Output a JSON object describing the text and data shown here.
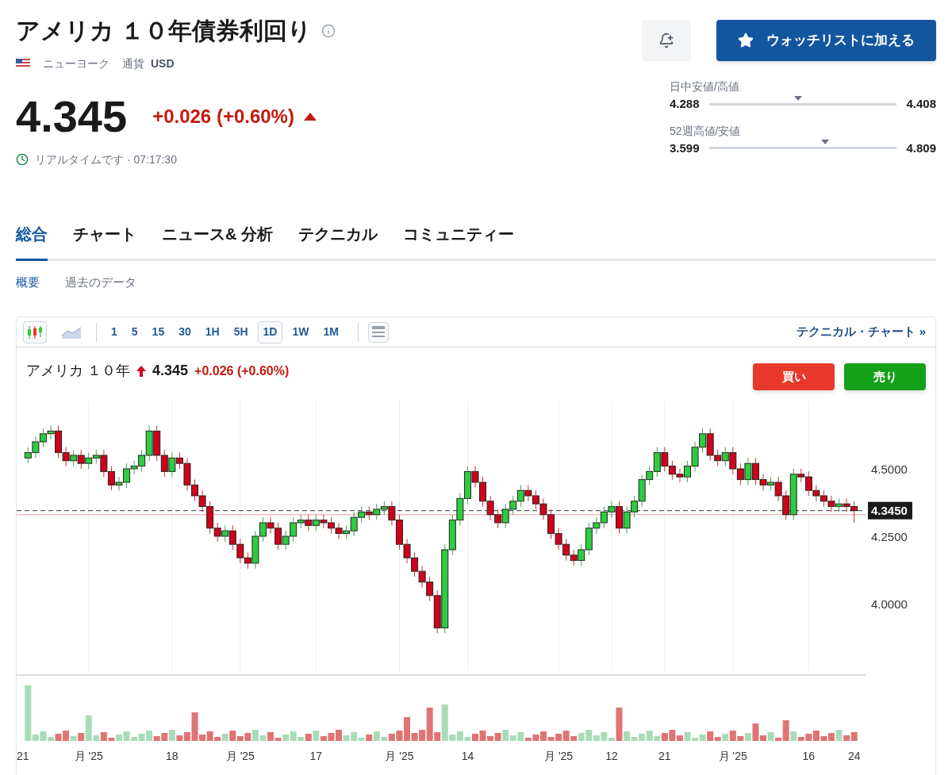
{
  "header": {
    "title": "アメリカ １０年債券利回り",
    "exchange": "ニューヨーク",
    "currency_label": "通貨",
    "currency": "USD",
    "watchlist_button": "ウォッチリストに加える"
  },
  "quote": {
    "price": "4.345",
    "change": "+0.026 (+0.60%)",
    "status": "リアルタイムです · 07:17:30"
  },
  "ranges": [
    {
      "label": "日中安値/高値",
      "low": "4.288",
      "high": "4.408",
      "level": 0.475
    },
    {
      "label": "52週高値/安値",
      "low": "3.599",
      "high": "4.809",
      "level": 0.62
    }
  ],
  "tabs": [
    {
      "label": "総合",
      "selected": true
    },
    {
      "label": "チャート",
      "selected": false
    },
    {
      "label": "ニュース& 分析",
      "selected": false
    },
    {
      "label": "テクニカル",
      "selected": false
    },
    {
      "label": "コミュニティー",
      "selected": false
    }
  ],
  "subtabs": [
    {
      "label": "概要",
      "selected": true
    },
    {
      "label": "過去のデータ",
      "selected": false
    }
  ],
  "chart_types": [
    {
      "kind": "candles",
      "selected": true
    },
    {
      "kind": "area",
      "selected": false
    }
  ],
  "intervals": [
    {
      "label": "1",
      "selected": false
    },
    {
      "label": "5",
      "selected": false
    },
    {
      "label": "15",
      "selected": false
    },
    {
      "label": "30",
      "selected": false
    },
    {
      "label": "1H",
      "selected": false
    },
    {
      "label": "5H",
      "selected": false
    },
    {
      "label": "1D",
      "selected": true
    },
    {
      "label": "1W",
      "selected": false
    },
    {
      "label": "1M",
      "selected": false
    }
  ],
  "technical_link": "テクニカル・チャート »",
  "legend": {
    "name": "アメリカ １０年",
    "price": "4.345",
    "change": "+0.026 (+0.60%)"
  },
  "buy_button": "買い",
  "sell_button": "売り",
  "chart_data": {
    "type": "candlestick",
    "ylim": [
      3.75,
      4.75
    ],
    "ref_lines": [
      {
        "axis": "y",
        "value": 4.345,
        "label": "4.3450",
        "color": "#333333"
      },
      {
        "axis": "y",
        "value": 4.33,
        "color": "#e4a0a0"
      }
    ],
    "categories": [
      "21",
      null,
      null,
      null,
      null,
      null,
      null,
      null,
      "月 '25",
      null,
      null,
      null,
      null,
      null,
      null,
      null,
      null,
      null,
      null,
      "18",
      null,
      null,
      null,
      null,
      null,
      null,
      null,
      null,
      "月 '25",
      null,
      null,
      null,
      null,
      null,
      null,
      null,
      null,
      null,
      "17",
      null,
      null,
      null,
      null,
      null,
      null,
      null,
      null,
      null,
      null,
      "月 '25",
      null,
      null,
      null,
      null,
      null,
      null,
      null,
      null,
      "14",
      null,
      null,
      null,
      null,
      null,
      null,
      null,
      null,
      null,
      null,
      null,
      "月 '25",
      null,
      null,
      null,
      null,
      null,
      null,
      "12",
      null,
      null,
      null,
      null,
      null,
      null,
      "21",
      null,
      null,
      null,
      null,
      null,
      null,
      null,
      null,
      "月 '25",
      null,
      null,
      null,
      null,
      null,
      null,
      null,
      null,
      null,
      "16",
      null,
      null,
      null,
      null,
      null,
      "24"
    ],
    "ohlc": [
      [
        4.54,
        4.58,
        4.52,
        4.56
      ],
      [
        4.56,
        4.62,
        4.54,
        4.6
      ],
      [
        4.6,
        4.65,
        4.58,
        4.63
      ],
      [
        4.63,
        4.66,
        4.61,
        4.64
      ],
      [
        4.64,
        4.66,
        4.54,
        4.56
      ],
      [
        4.56,
        4.58,
        4.51,
        4.53
      ],
      [
        4.53,
        4.57,
        4.51,
        4.55
      ],
      [
        4.55,
        4.57,
        4.5,
        4.52
      ],
      [
        4.52,
        4.56,
        4.5,
        4.54
      ],
      [
        4.54,
        4.57,
        4.52,
        4.55
      ],
      [
        4.55,
        4.57,
        4.47,
        4.49
      ],
      [
        4.49,
        4.51,
        4.42,
        4.44
      ],
      [
        4.44,
        4.47,
        4.42,
        4.45
      ],
      [
        4.45,
        4.52,
        4.43,
        4.5
      ],
      [
        4.5,
        4.53,
        4.48,
        4.51
      ],
      [
        4.51,
        4.57,
        4.49,
        4.55
      ],
      [
        4.55,
        4.66,
        4.53,
        4.64
      ],
      [
        4.64,
        4.66,
        4.53,
        4.55
      ],
      [
        4.55,
        4.57,
        4.47,
        4.49
      ],
      [
        4.49,
        4.56,
        4.47,
        4.54
      ],
      [
        4.54,
        4.56,
        4.5,
        4.52
      ],
      [
        4.52,
        4.54,
        4.42,
        4.44
      ],
      [
        4.44,
        4.46,
        4.38,
        4.4
      ],
      [
        4.4,
        4.42,
        4.34,
        4.36
      ],
      [
        4.36,
        4.38,
        4.26,
        4.28
      ],
      [
        4.28,
        4.3,
        4.23,
        4.25
      ],
      [
        4.25,
        4.29,
        4.23,
        4.27
      ],
      [
        4.27,
        4.29,
        4.2,
        4.22
      ],
      [
        4.22,
        4.24,
        4.15,
        4.17
      ],
      [
        4.17,
        4.19,
        4.13,
        4.15
      ],
      [
        4.15,
        4.27,
        4.13,
        4.25
      ],
      [
        4.25,
        4.32,
        4.23,
        4.3
      ],
      [
        4.3,
        4.32,
        4.26,
        4.28
      ],
      [
        4.28,
        4.3,
        4.2,
        4.22
      ],
      [
        4.22,
        4.27,
        4.2,
        4.25
      ],
      [
        4.25,
        4.32,
        4.23,
        4.3
      ],
      [
        4.3,
        4.33,
        4.28,
        4.31
      ],
      [
        4.31,
        4.33,
        4.27,
        4.29
      ],
      [
        4.29,
        4.33,
        4.27,
        4.31
      ],
      [
        4.31,
        4.33,
        4.28,
        4.3
      ],
      [
        4.3,
        4.32,
        4.26,
        4.28
      ],
      [
        4.28,
        4.3,
        4.24,
        4.26
      ],
      [
        4.26,
        4.29,
        4.24,
        4.27
      ],
      [
        4.27,
        4.34,
        4.25,
        4.32
      ],
      [
        4.32,
        4.36,
        4.3,
        4.34
      ],
      [
        4.34,
        4.36,
        4.31,
        4.33
      ],
      [
        4.33,
        4.37,
        4.31,
        4.35
      ],
      [
        4.35,
        4.38,
        4.33,
        4.36
      ],
      [
        4.36,
        4.38,
        4.29,
        4.31
      ],
      [
        4.31,
        4.33,
        4.2,
        4.22
      ],
      [
        4.22,
        4.24,
        4.15,
        4.17
      ],
      [
        4.17,
        4.19,
        4.1,
        4.12
      ],
      [
        4.12,
        4.14,
        4.06,
        4.08
      ],
      [
        4.08,
        4.1,
        4.01,
        4.03
      ],
      [
        4.03,
        4.05,
        3.89,
        3.91
      ],
      [
        3.91,
        4.22,
        3.89,
        4.2
      ],
      [
        4.2,
        4.33,
        4.18,
        4.31
      ],
      [
        4.31,
        4.41,
        4.29,
        4.39
      ],
      [
        4.39,
        4.51,
        4.37,
        4.49
      ],
      [
        4.49,
        4.51,
        4.43,
        4.45
      ],
      [
        4.45,
        4.47,
        4.36,
        4.38
      ],
      [
        4.38,
        4.4,
        4.31,
        4.33
      ],
      [
        4.33,
        4.35,
        4.28,
        4.3
      ],
      [
        4.3,
        4.37,
        4.28,
        4.35
      ],
      [
        4.35,
        4.4,
        4.33,
        4.38
      ],
      [
        4.38,
        4.44,
        4.36,
        4.42
      ],
      [
        4.42,
        4.44,
        4.38,
        4.4
      ],
      [
        4.4,
        4.42,
        4.35,
        4.37
      ],
      [
        4.37,
        4.39,
        4.31,
        4.33
      ],
      [
        4.33,
        4.35,
        4.24,
        4.26
      ],
      [
        4.26,
        4.28,
        4.2,
        4.22
      ],
      [
        4.22,
        4.24,
        4.16,
        4.18
      ],
      [
        4.18,
        4.2,
        4.14,
        4.16
      ],
      [
        4.16,
        4.22,
        4.14,
        4.2
      ],
      [
        4.2,
        4.3,
        4.18,
        4.28
      ],
      [
        4.28,
        4.32,
        4.26,
        4.3
      ],
      [
        4.3,
        4.36,
        4.28,
        4.34
      ],
      [
        4.34,
        4.38,
        4.32,
        4.36
      ],
      [
        4.36,
        4.38,
        4.26,
        4.28
      ],
      [
        4.28,
        4.36,
        4.26,
        4.34
      ],
      [
        4.34,
        4.4,
        4.32,
        4.38
      ],
      [
        4.38,
        4.48,
        4.36,
        4.46
      ],
      [
        4.46,
        4.51,
        4.44,
        4.49
      ],
      [
        4.49,
        4.58,
        4.47,
        4.56
      ],
      [
        4.56,
        4.58,
        4.49,
        4.51
      ],
      [
        4.51,
        4.53,
        4.46,
        4.48
      ],
      [
        4.48,
        4.5,
        4.45,
        4.47
      ],
      [
        4.47,
        4.53,
        4.45,
        4.51
      ],
      [
        4.51,
        4.6,
        4.49,
        4.58
      ],
      [
        4.58,
        4.65,
        4.56,
        4.63
      ],
      [
        4.63,
        4.65,
        4.53,
        4.55
      ],
      [
        4.55,
        4.57,
        4.51,
        4.53
      ],
      [
        4.53,
        4.58,
        4.51,
        4.56
      ],
      [
        4.56,
        4.58,
        4.48,
        4.5
      ],
      [
        4.5,
        4.52,
        4.44,
        4.46
      ],
      [
        4.46,
        4.54,
        4.44,
        4.52
      ],
      [
        4.52,
        4.54,
        4.44,
        4.46
      ],
      [
        4.46,
        4.48,
        4.42,
        4.44
      ],
      [
        4.44,
        4.47,
        4.42,
        4.45
      ],
      [
        4.45,
        4.47,
        4.38,
        4.4
      ],
      [
        4.4,
        4.42,
        4.31,
        4.33
      ],
      [
        4.33,
        4.5,
        4.31,
        4.48
      ],
      [
        4.48,
        4.5,
        4.45,
        4.47
      ],
      [
        4.47,
        4.49,
        4.4,
        4.42
      ],
      [
        4.42,
        4.44,
        4.38,
        4.4
      ],
      [
        4.4,
        4.42,
        4.36,
        4.38
      ],
      [
        4.38,
        4.4,
        4.34,
        4.36
      ],
      [
        4.36,
        4.39,
        4.34,
        4.37
      ],
      [
        4.37,
        4.39,
        4.34,
        4.36
      ],
      [
        4.36,
        4.38,
        4.3,
        4.345
      ]
    ],
    "yticks": [
      {
        "value": 4.5,
        "label": "4.5000"
      },
      {
        "value": 4.25,
        "label": "4.2500"
      },
      {
        "value": 4.0,
        "label": "4.0000"
      }
    ]
  }
}
